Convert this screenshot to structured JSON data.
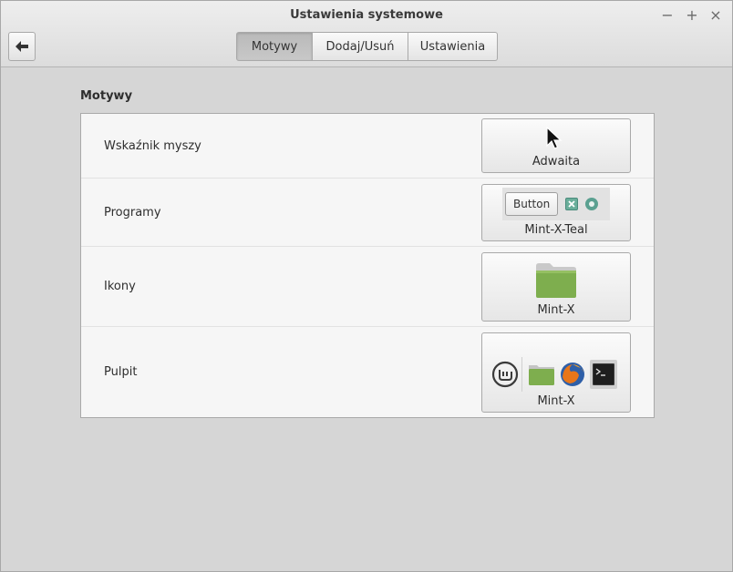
{
  "window": {
    "title": "Ustawienia systemowe",
    "controls": {
      "minimize": "−",
      "maximize": "+",
      "close": "×"
    }
  },
  "toolbar": {
    "back_icon": "arrow-left-icon",
    "tabs": [
      {
        "label": "Motywy",
        "active": true
      },
      {
        "label": "Dodaj/Usuń",
        "active": false
      },
      {
        "label": "Ustawienia",
        "active": false
      }
    ]
  },
  "main": {
    "section_title": "Motywy",
    "rows": [
      {
        "label": "Wskaźnik myszy",
        "theme": "Adwaita",
        "preview": "mouse-cursor-icon"
      },
      {
        "label": "Programy",
        "theme": "Mint-X-Teal",
        "preview_button": "Button"
      },
      {
        "label": "Ikony",
        "theme": "Mint-X",
        "preview": "folder-icon"
      },
      {
        "label": "Pulpit",
        "theme": "Mint-X",
        "preview": "panel-preview"
      }
    ]
  },
  "colors": {
    "accent": "#5aa090",
    "folder": "#7eae4e",
    "background": "#d6d6d6"
  }
}
